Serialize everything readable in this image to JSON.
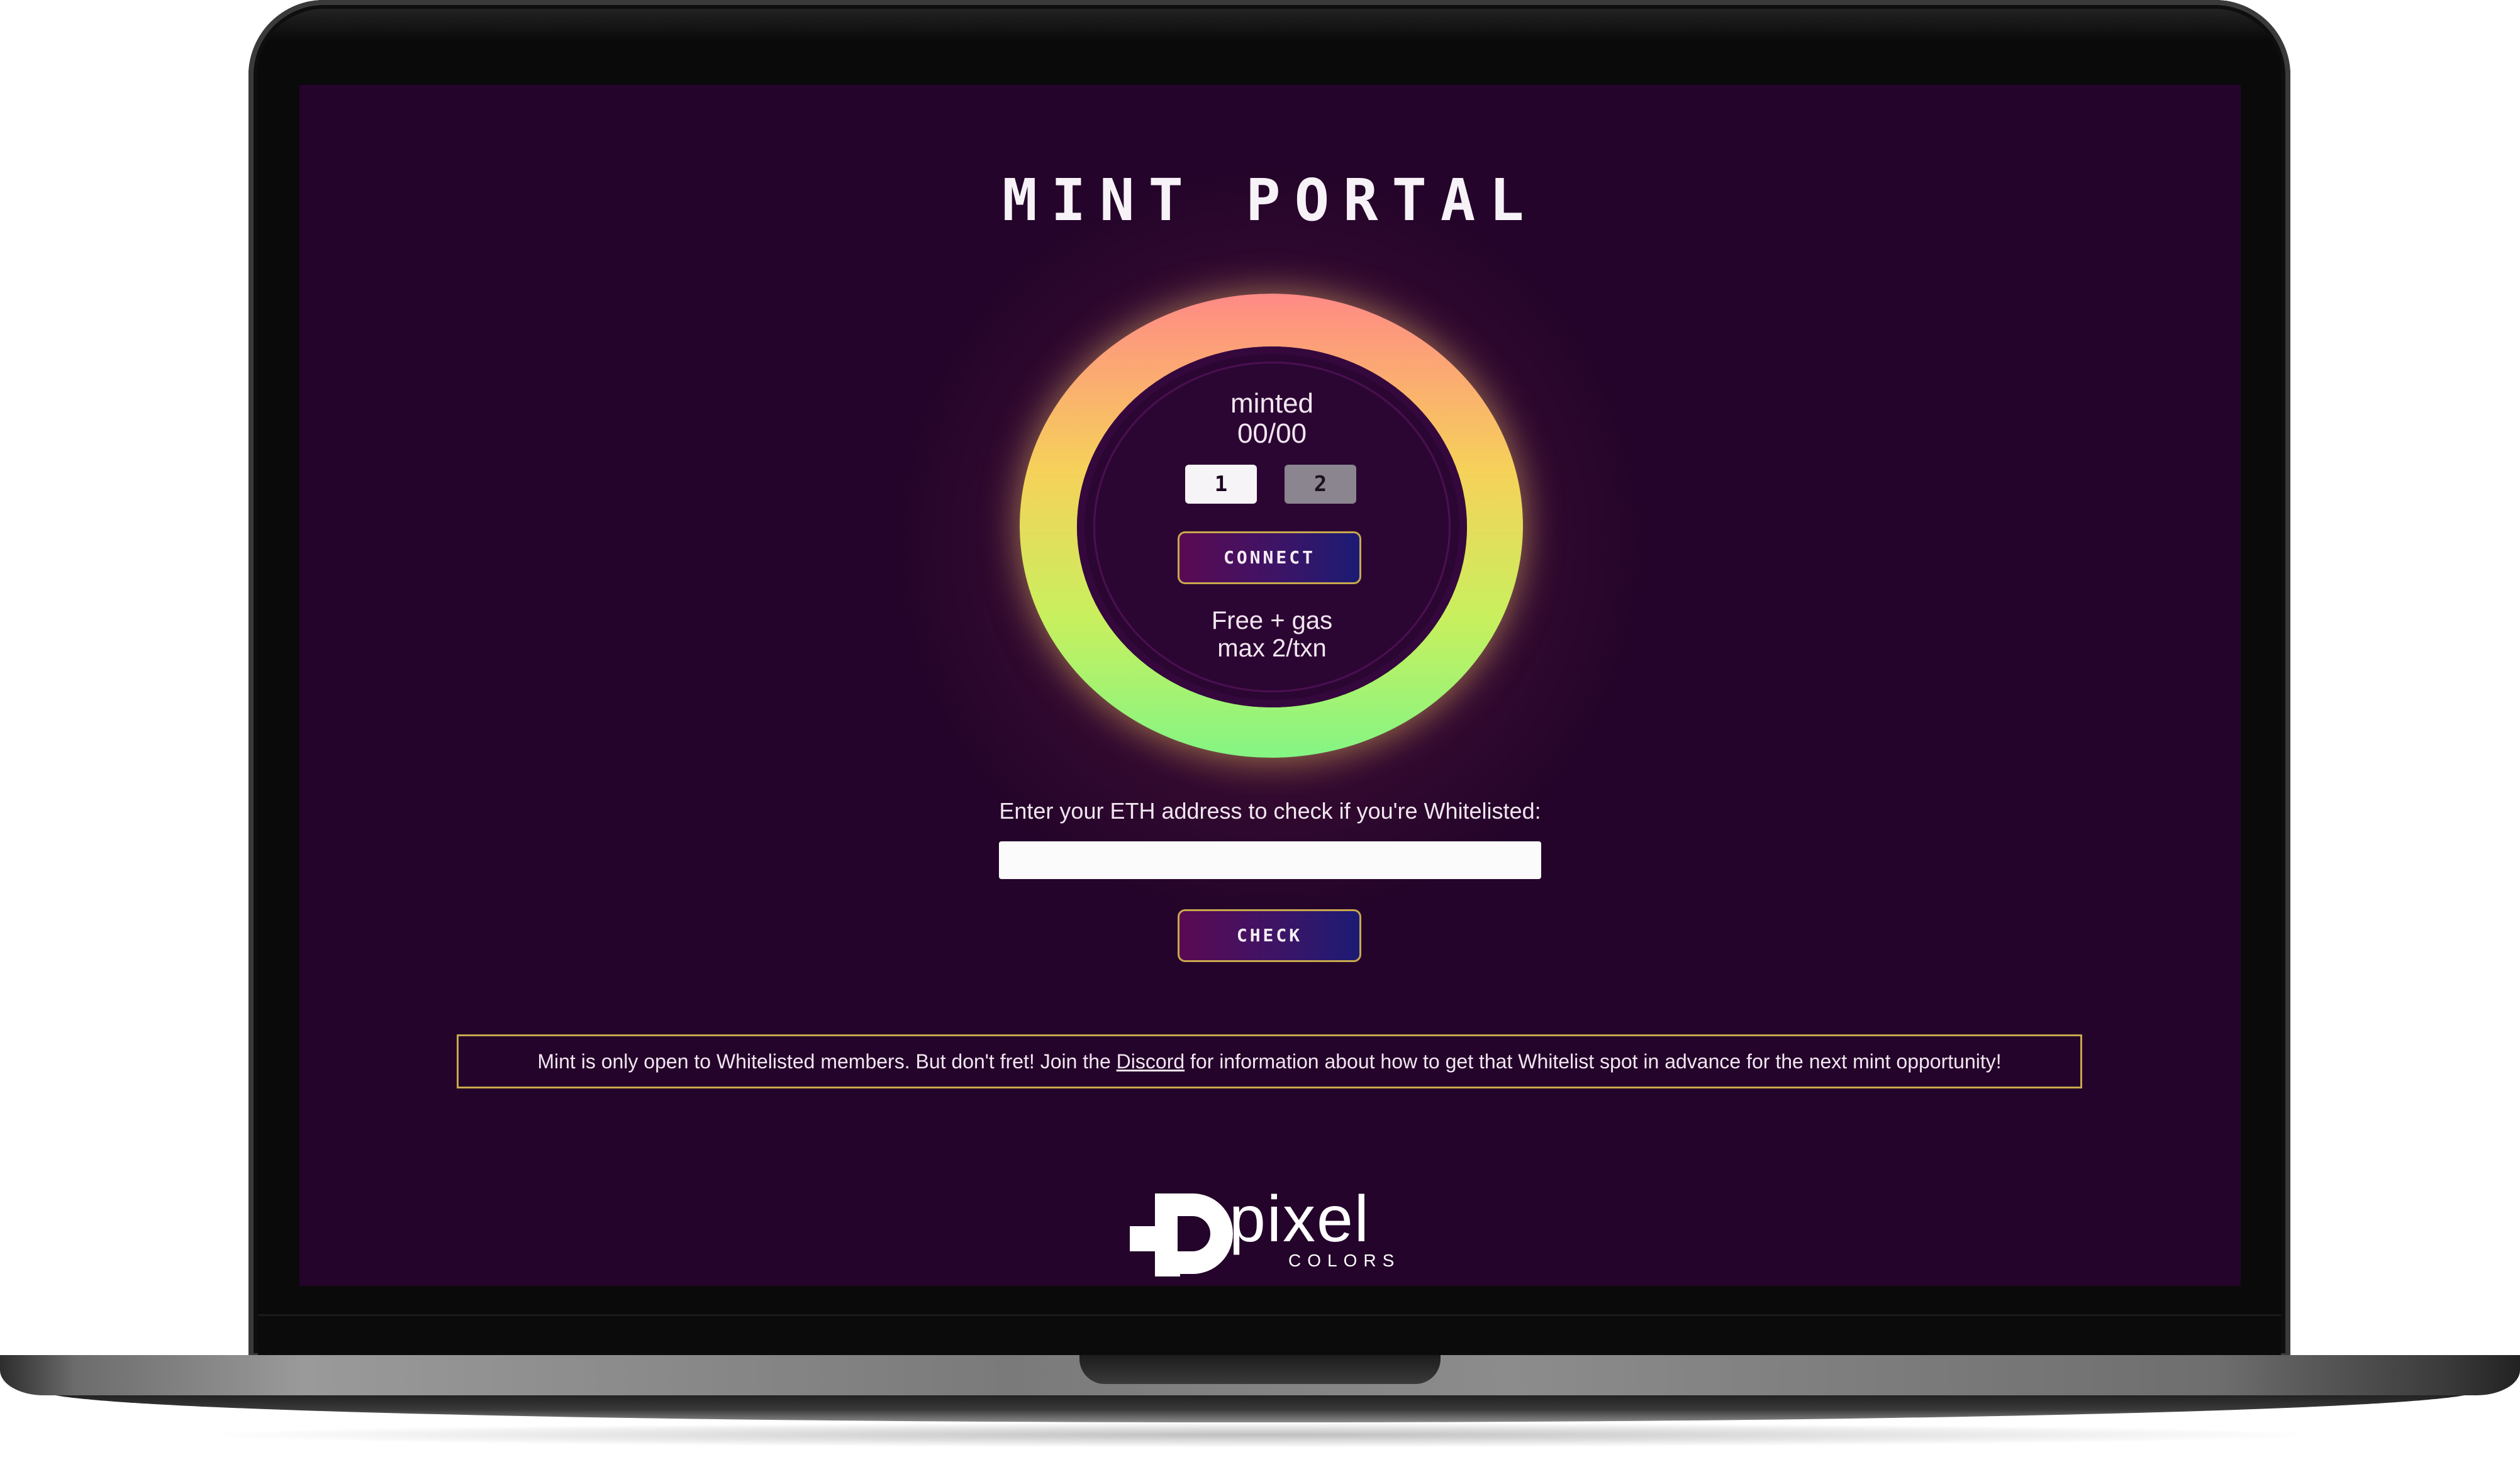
{
  "page": {
    "title": "MINT PORTAL"
  },
  "mint": {
    "minted_label": "minted",
    "minted_count": "00/00",
    "quantity_options": [
      "1",
      "2"
    ],
    "connect_label": "CONNECT",
    "price_text": "Free + gas",
    "limit_text": "max 2/txn"
  },
  "whitelist": {
    "prompt": "Enter your ETH address to check if you're Whitelisted:",
    "input_value": "",
    "input_placeholder": "",
    "check_label": "CHECK"
  },
  "notice": {
    "before_link": "Mint is only open to Whitelisted members. But don't fret! Join the ",
    "link_text": "Discord",
    "after_link": " for information about how to get that Whitelist spot in advance for the next mint opportunity!"
  },
  "brand": {
    "logo_icon": "pixel-p-logo-icon",
    "name": "pixel",
    "sub": "COLORS"
  },
  "colors": {
    "background": "#24042a",
    "ring_top": "#ff8a86",
    "ring_mid": "#f6d15a",
    "ring_bottom": "#84f584",
    "button_border": "#c8a84e"
  }
}
